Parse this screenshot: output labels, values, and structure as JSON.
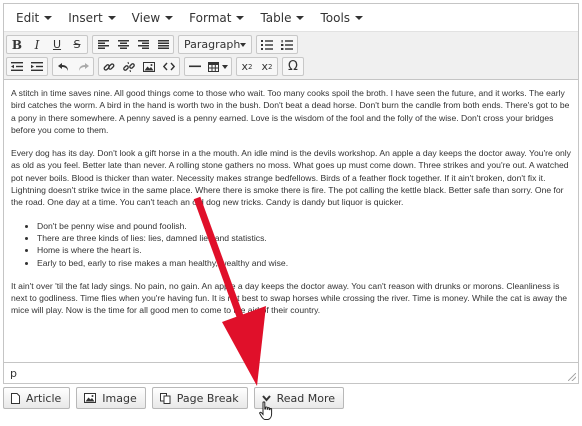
{
  "menubar": {
    "items": [
      {
        "label": "Edit"
      },
      {
        "label": "Insert"
      },
      {
        "label": "View"
      },
      {
        "label": "Format"
      },
      {
        "label": "Table"
      },
      {
        "label": "Tools"
      }
    ]
  },
  "toolbar": {
    "bold": "B",
    "italic": "I",
    "underline": "U",
    "strikethrough": "S",
    "format_select": "Paragraph",
    "subscript": "x",
    "subscript_sub": "2",
    "superscript": "x",
    "superscript_sup": "2",
    "special_char": "Ω"
  },
  "content": {
    "paragraphs": [
      "A stitch in time saves nine.  All good things come to those who wait.  Too  many cooks spoil the broth.  I have seen the future, and it works.  The  early bird catches the worm.  A bird in the hand is worth two in the  bush.  Don't beat a dead horse.  Don't burn the candle from both ends.   There's got to be a pony in there somewhere.  A penny saved is a penny  earned.  Love is the wisdom of the fool and the folly of the wise.   Don't cross your bridges before you come to them.",
      "Every dog has its day.  Don't look a gift  horse in a the mouth.  An idle mind is the devils workshop.  An apple  a day keeps the doctor away. You're only as old as you feel.  Better  late than never.  A rolling stone gathers no moss. What goes up must  come down.  Three strikes and you're out.  A watched pot never boils.   Blood is thicker than water.  Necessity makes strange bedfellows.   Birds of a feather flock together. If it ain't broken, don't fix it.   Lightning doesn't strike twice in the same place.  Where there is  smoke there is fire.  The pot calling the kettle black.  Better safe  than sorry.  One for the road.  One day at a time.  You can't teach an  old dog new tricks.  Candy is dandy but liquor is quicker."
    ],
    "list": [
      "Don't be penny wise  and pound foolish.",
      "There are three kinds of lies: lies, damned lies  and statistics.",
      "Home is where the heart is.",
      "Early to bed, early to  rise makes a man healthy, wealthy and wise."
    ],
    "last_paragraph": "It ain't over 'til the fat  lady sings.  No pain, no gain.  An apple a day keeps the doctor away.   You can't reason with drunks or morons. Cleanliness is next to  godliness. Time flies when you're having fun.  It is not best to swap  horses while crossing the river.  Time is money.  While the cat is  away the mice will play.  Now is the time for all good men to come to  the aid of their country."
  },
  "statusbar": {
    "path": "p"
  },
  "buttons": {
    "article": "Article",
    "image": "Image",
    "page_break": "Page Break",
    "read_more": "Read More"
  },
  "colors": {
    "arrow": "#e0102a"
  }
}
